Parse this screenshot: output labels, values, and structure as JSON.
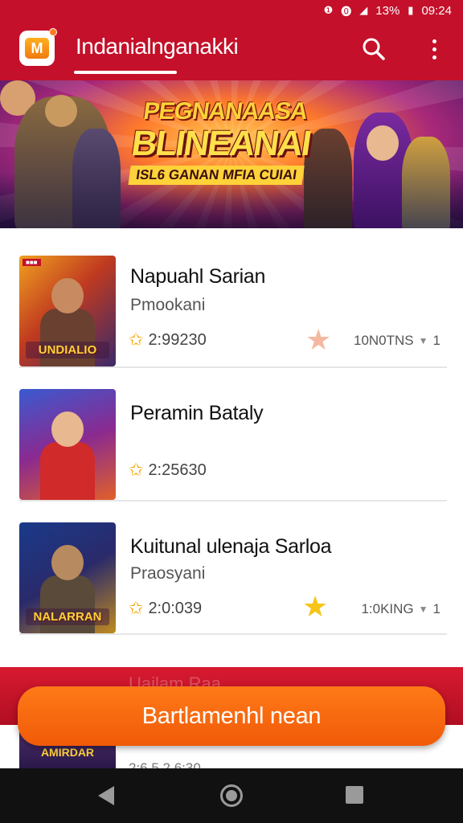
{
  "status_bar": {
    "icons": [
      "notification-icon",
      "notification-icon",
      "signal-icon",
      "battery-icon"
    ],
    "battery": "13%",
    "time": "09:24"
  },
  "app_bar": {
    "title": "Indanialnganakki",
    "logo_letter": "M"
  },
  "banner": {
    "line1": "PEGNANAASA",
    "line2": "BLINEANAI",
    "line3": "ISL6 GANAN MFIA CUIAI"
  },
  "games": [
    {
      "title": "Napuahl Sarian",
      "subtitle": "Pmookani",
      "rating": "2:99230",
      "rank": "10N0TNS",
      "rank_suffix": "1",
      "thumb_logo": "UNDIALIO"
    },
    {
      "title": "Peramin Bataly",
      "subtitle": "",
      "rating": "2:25630",
      "rank": "",
      "rank_suffix": "",
      "thumb_logo": ""
    },
    {
      "title": "Kuitunal ulenaja Sarloa",
      "subtitle": "Praosyani",
      "rating": "2:0:039",
      "rank": "1:0KING",
      "rank_suffix": "1",
      "thumb_logo": "NALARRAN"
    }
  ],
  "cta": {
    "label": "Bartlamenhl nean",
    "ghost_text": "Uailam Raa"
  },
  "peek": {
    "logo": "AMIRDAR",
    "rating": "2:6.5 2.6:30"
  },
  "colors": {
    "brand_red": "#c4102a",
    "cta_orange": "#f56a10",
    "star_gold": "#f2a800"
  }
}
